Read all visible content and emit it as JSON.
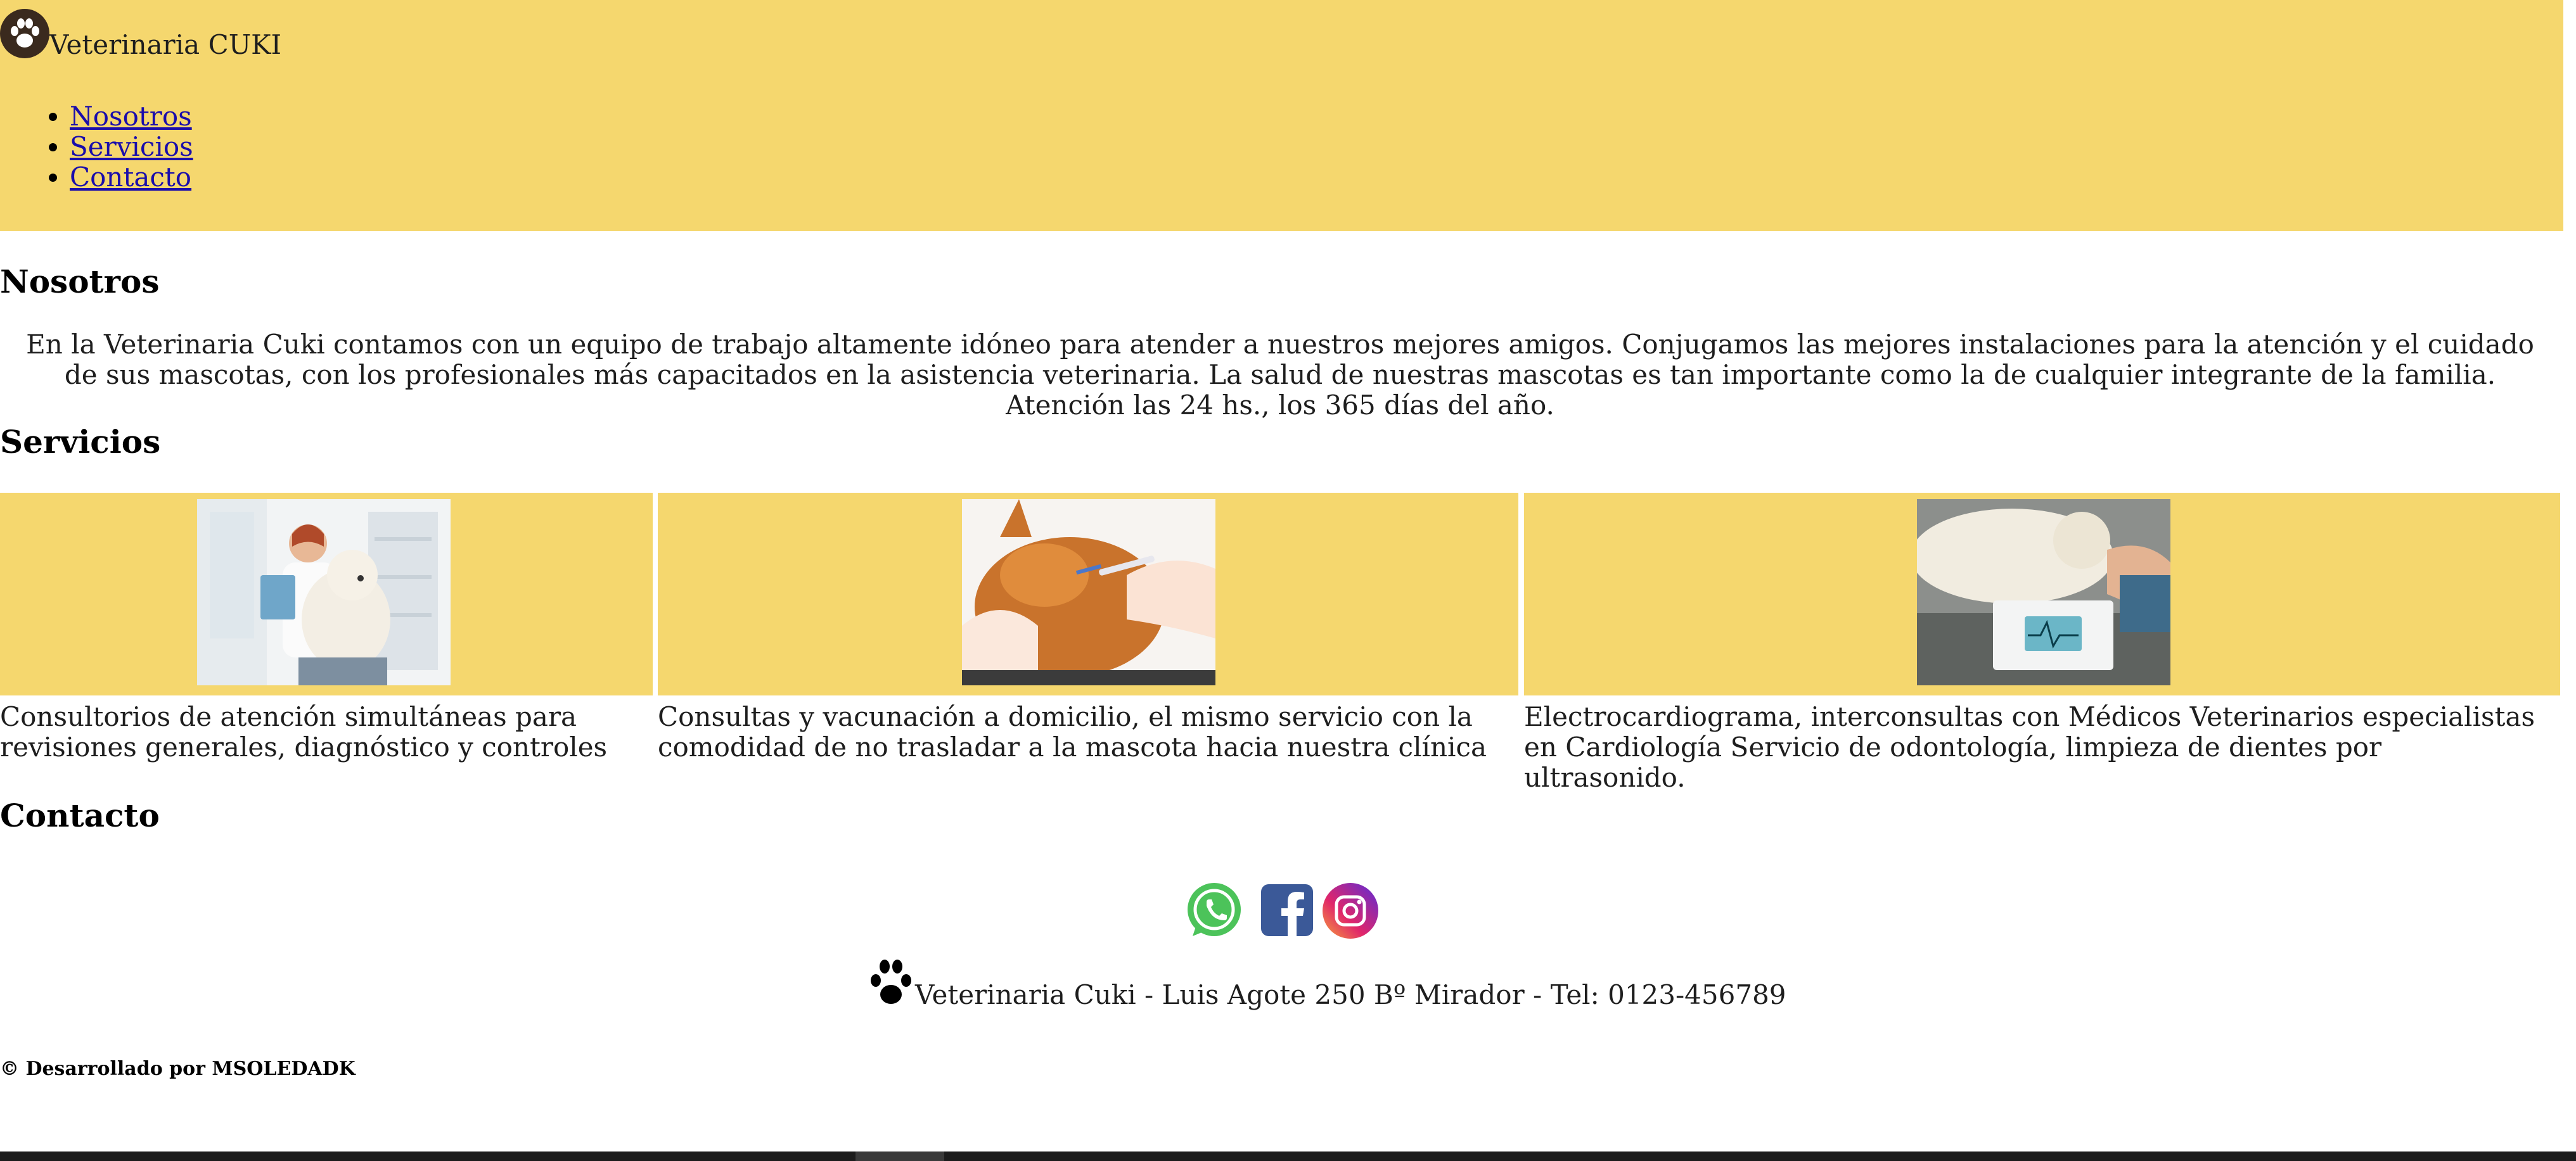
{
  "header": {
    "brand": "Veterinaria CUKI",
    "nav": [
      "Nosotros",
      "Servicios",
      "Contacto"
    ]
  },
  "about": {
    "title": "Nosotros",
    "text": "En la Veterinaria Cuki contamos con un equipo de trabajo altamente idóneo para atender a nuestros mejores amigos. Conjugamos las mejores instalaciones para la atención y el cuidado de sus mascotas, con los profesionales más capacitados en la asistencia veterinaria. La salud de nuestras mascotas es tan importante como la de cualquier integrante de la familia. Atención las 24 hs., los 365 días del año."
  },
  "services": {
    "title": "Servicios",
    "items": [
      {
        "caption": "Consultorios de atención simultáneas para revisiones generales, diagnóstico y controles"
      },
      {
        "caption": "Consultas y vacunación a domicilio, el mismo servicio con la comodidad de no trasladar a la mascota hacia nuestra clínica"
      },
      {
        "caption": "Electrocardiograma, interconsultas con Médicos Veterinarios especialistas en Cardiología Servicio de odontología, limpieza de dientes por ultrasonido."
      }
    ]
  },
  "contact": {
    "title": "Contacto",
    "icons": [
      "whatsapp-icon",
      "facebook-icon",
      "instagram-icon"
    ]
  },
  "footer": {
    "address": "Veterinaria Cuki - Luis Agote 250 Bº Mirador - Tel: 0123-456789",
    "credits": "© Desarrollado por MSOLEDADK"
  },
  "colors": {
    "header_bg": "#f5d76e",
    "link": "#1a0dab"
  }
}
